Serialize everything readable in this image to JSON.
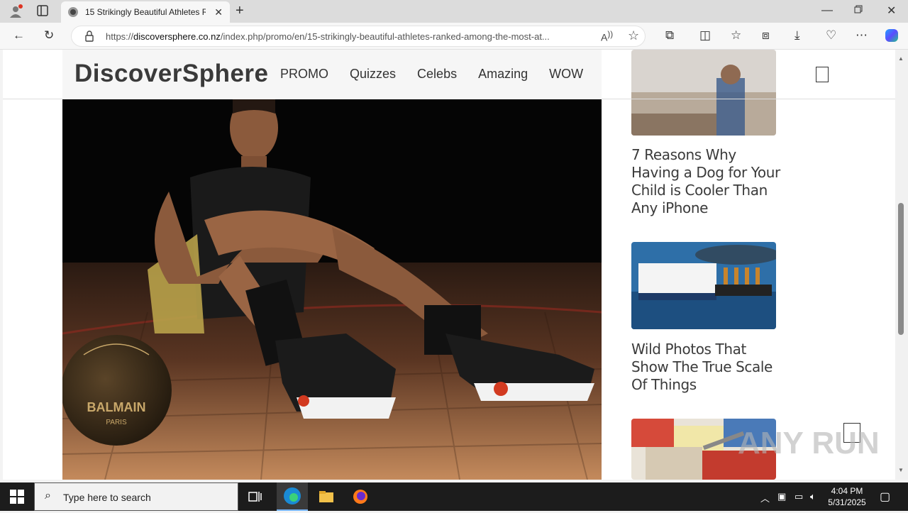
{
  "browser": {
    "tab_title": "15 Strikingly Beautiful Athletes R",
    "url_prefix": "https://",
    "url_domain": "discoversphere.co.nz",
    "url_path": "/index.php/promo/en/15-strikingly-beautiful-athletes-ranked-among-the-most-at..."
  },
  "site": {
    "logo": "DiscoverSphere",
    "nav": [
      "PROMO",
      "Quizzes",
      "Celebs",
      "Amazing",
      "WOW"
    ]
  },
  "sidebar": {
    "articles": [
      {
        "title": "7 Reasons Why Having a Dog for Your Child is Cooler Than Any iPhone"
      },
      {
        "title": "Wild Photos That Show The True Scale Of Things"
      }
    ]
  },
  "watermark": "ANY RUN",
  "taskbar": {
    "search_placeholder": "Type here to search",
    "time": "4:04 PM",
    "date": "5/31/2025"
  }
}
